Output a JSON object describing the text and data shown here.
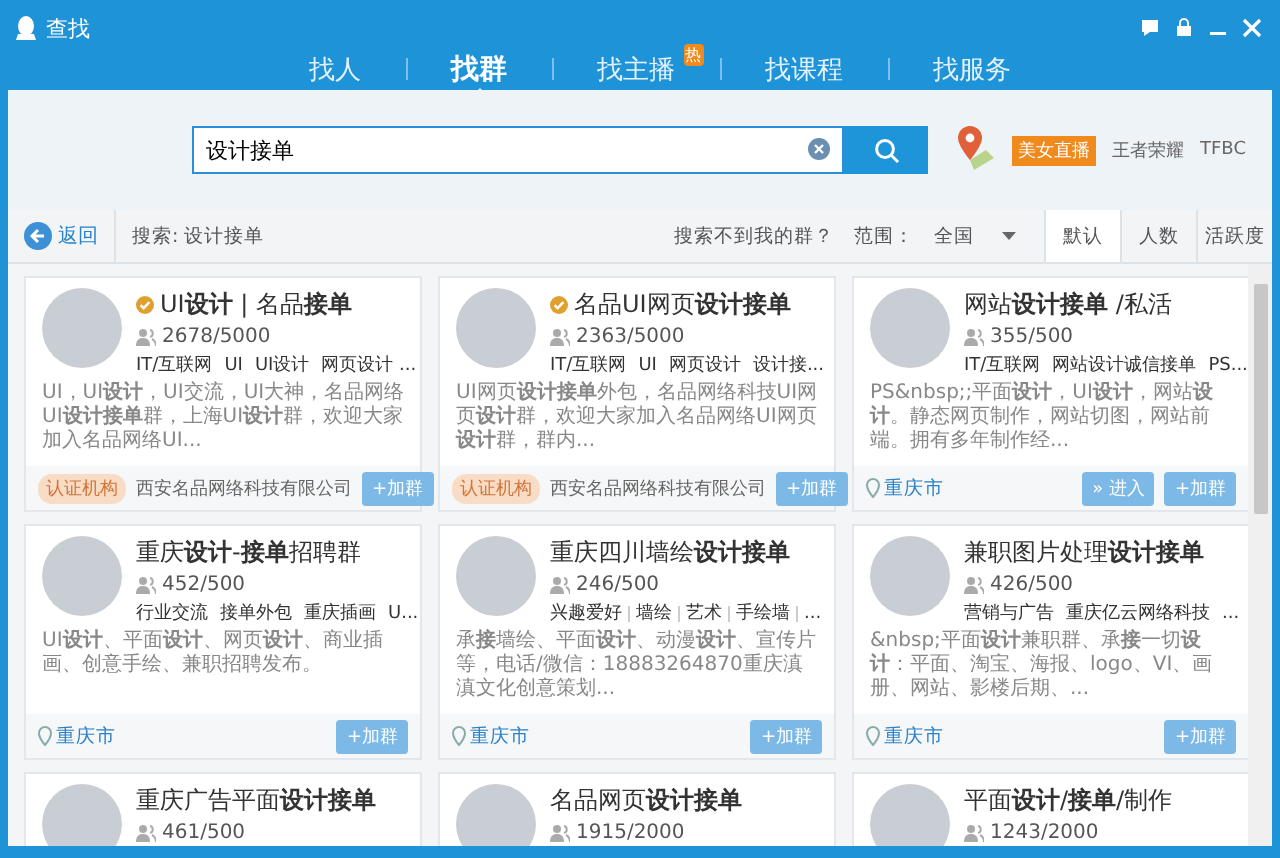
{
  "window": {
    "title": "查找"
  },
  "tabs": [
    {
      "label": "找人",
      "selected": false
    },
    {
      "label": "找群",
      "selected": true
    },
    {
      "label": "找主播",
      "selected": false,
      "badge": "热"
    },
    {
      "label": "找课程",
      "selected": false
    },
    {
      "label": "找服务",
      "selected": false
    }
  ],
  "search": {
    "value": "设计接单"
  },
  "hot_links": [
    {
      "label": "美女直播",
      "kind": "badge"
    },
    {
      "label": "王者荣耀",
      "kind": "plain"
    },
    {
      "label": "TFBC",
      "kind": "plain"
    }
  ],
  "filter_bar": {
    "back": "返回",
    "query": "搜索: 设计接单",
    "help_link": "搜索不到我的群？",
    "range_label": "范围：",
    "range_value": "全国"
  },
  "sort_tabs": [
    {
      "label": "默认",
      "selected": true
    },
    {
      "label": "人数",
      "selected": false
    },
    {
      "label": "活跃度",
      "selected": false
    }
  ],
  "cards": [
    {
      "title": "UI**设计** | 名品**接单**",
      "verified": true,
      "members": "2678/5000",
      "tags": [
        "IT/互联网",
        "UI",
        "UI设计",
        "网页设计 ..."
      ],
      "description": "UI，UI**设计**，UI交流，UI大神，名品网络UI**设计接单**群，上海UI**设计**群，欢迎大家加入名品网络UI...",
      "footer": {
        "kind": "org",
        "badge": "认证机构",
        "text": "西安名品网络科技有限公司"
      },
      "buttons": [
        "+加群"
      ]
    },
    {
      "title": "名品UI网页**设计接单**",
      "verified": true,
      "members": "2363/5000",
      "tags": [
        "IT/互联网",
        "UI",
        "网页设计",
        "设计接..."
      ],
      "description": "UI网页**设计接单**外包，名品网络科技UI网页**设计**群，欢迎大家加入名品网络UI网页**设计**群，群内...",
      "footer": {
        "kind": "org",
        "badge": "认证机构",
        "text": "西安名品网络科技有限公司"
      },
      "buttons": [
        "+加群"
      ]
    },
    {
      "title": "网站**设计接单** /私活",
      "verified": false,
      "members": "355/500",
      "tags": [
        "IT/互联网",
        "网站设计诚信接单",
        "PS..."
      ],
      "description": "PS&nbsp;;平面**设计**，UI**设计**，网站**设计**。静态网页制作，网站切图，网站前端。拥有多年制作经...",
      "footer": {
        "kind": "location",
        "text": "重庆市"
      },
      "buttons": [
        "» 进入",
        "+加群"
      ]
    },
    {
      "title": "重庆**设计**-**接单**招聘群",
      "verified": false,
      "members": "452/500",
      "tags": [
        "行业交流",
        "接单外包",
        "重庆插画",
        "U..."
      ],
      "description": "UI**设计**、平面**设计**、网页**设计**、商业插画、创意手绘、兼职招聘发布。",
      "footer": {
        "kind": "location",
        "text": "重庆市"
      },
      "buttons": [
        "+加群"
      ]
    },
    {
      "title": "重庆四川墙绘**设计接单**",
      "verified": false,
      "members": "246/500",
      "tags": [
        "兴趣爱好",
        "墙绘",
        "艺术",
        "手绘墙",
        "..."
      ],
      "description": "承**接**墙绘、平面**设计**、动漫**设计**、宣传片等，电话/微信：18883264870重庆滇滇文化创意策划...",
      "footer": {
        "kind": "location",
        "text": "重庆市"
      },
      "buttons": [
        "+加群"
      ]
    },
    {
      "title": "兼职图片处理**设计接单**",
      "verified": false,
      "members": "426/500",
      "tags": [
        "营销与广告",
        "重庆亿云网络科技",
        "..."
      ],
      "description": "&nbsp;平面**设计**兼职群、承**接**一切**设计**：平面、淘宝、海报、logo、VI、画册、网站、影楼后期、...",
      "footer": {
        "kind": "location",
        "text": "重庆市"
      },
      "buttons": [
        "+加群"
      ]
    },
    {
      "title": "重庆广告平面**设计接单**",
      "verified": false,
      "members": "461/500"
    },
    {
      "title": "名品网页**设计接单**",
      "verified": false,
      "members": "1915/2000"
    },
    {
      "title": "平面**设计**/**接单**/制作",
      "verified": false,
      "members": "1243/2000"
    }
  ]
}
